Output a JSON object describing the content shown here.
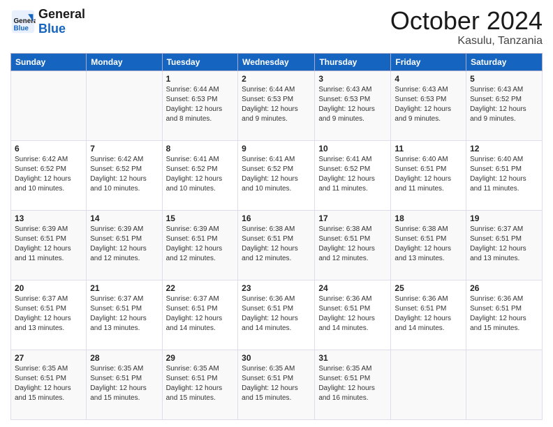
{
  "header": {
    "logo_general": "General",
    "logo_blue": "Blue",
    "month": "October 2024",
    "location": "Kasulu, Tanzania"
  },
  "weekdays": [
    "Sunday",
    "Monday",
    "Tuesday",
    "Wednesday",
    "Thursday",
    "Friday",
    "Saturday"
  ],
  "weeks": [
    [
      null,
      null,
      {
        "day": 1,
        "sunrise": "6:44 AM",
        "sunset": "6:53 PM",
        "daylight": "12 hours and 8 minutes."
      },
      {
        "day": 2,
        "sunrise": "6:44 AM",
        "sunset": "6:53 PM",
        "daylight": "12 hours and 9 minutes."
      },
      {
        "day": 3,
        "sunrise": "6:43 AM",
        "sunset": "6:53 PM",
        "daylight": "12 hours and 9 minutes."
      },
      {
        "day": 4,
        "sunrise": "6:43 AM",
        "sunset": "6:53 PM",
        "daylight": "12 hours and 9 minutes."
      },
      {
        "day": 5,
        "sunrise": "6:43 AM",
        "sunset": "6:52 PM",
        "daylight": "12 hours and 9 minutes."
      }
    ],
    [
      {
        "day": 6,
        "sunrise": "6:42 AM",
        "sunset": "6:52 PM",
        "daylight": "12 hours and 10 minutes."
      },
      {
        "day": 7,
        "sunrise": "6:42 AM",
        "sunset": "6:52 PM",
        "daylight": "12 hours and 10 minutes."
      },
      {
        "day": 8,
        "sunrise": "6:41 AM",
        "sunset": "6:52 PM",
        "daylight": "12 hours and 10 minutes."
      },
      {
        "day": 9,
        "sunrise": "6:41 AM",
        "sunset": "6:52 PM",
        "daylight": "12 hours and 10 minutes."
      },
      {
        "day": 10,
        "sunrise": "6:41 AM",
        "sunset": "6:52 PM",
        "daylight": "12 hours and 11 minutes."
      },
      {
        "day": 11,
        "sunrise": "6:40 AM",
        "sunset": "6:51 PM",
        "daylight": "12 hours and 11 minutes."
      },
      {
        "day": 12,
        "sunrise": "6:40 AM",
        "sunset": "6:51 PM",
        "daylight": "12 hours and 11 minutes."
      }
    ],
    [
      {
        "day": 13,
        "sunrise": "6:39 AM",
        "sunset": "6:51 PM",
        "daylight": "12 hours and 11 minutes."
      },
      {
        "day": 14,
        "sunrise": "6:39 AM",
        "sunset": "6:51 PM",
        "daylight": "12 hours and 12 minutes."
      },
      {
        "day": 15,
        "sunrise": "6:39 AM",
        "sunset": "6:51 PM",
        "daylight": "12 hours and 12 minutes."
      },
      {
        "day": 16,
        "sunrise": "6:38 AM",
        "sunset": "6:51 PM",
        "daylight": "12 hours and 12 minutes."
      },
      {
        "day": 17,
        "sunrise": "6:38 AM",
        "sunset": "6:51 PM",
        "daylight": "12 hours and 12 minutes."
      },
      {
        "day": 18,
        "sunrise": "6:38 AM",
        "sunset": "6:51 PM",
        "daylight": "12 hours and 13 minutes."
      },
      {
        "day": 19,
        "sunrise": "6:37 AM",
        "sunset": "6:51 PM",
        "daylight": "12 hours and 13 minutes."
      }
    ],
    [
      {
        "day": 20,
        "sunrise": "6:37 AM",
        "sunset": "6:51 PM",
        "daylight": "12 hours and 13 minutes."
      },
      {
        "day": 21,
        "sunrise": "6:37 AM",
        "sunset": "6:51 PM",
        "daylight": "12 hours and 13 minutes."
      },
      {
        "day": 22,
        "sunrise": "6:37 AM",
        "sunset": "6:51 PM",
        "daylight": "12 hours and 14 minutes."
      },
      {
        "day": 23,
        "sunrise": "6:36 AM",
        "sunset": "6:51 PM",
        "daylight": "12 hours and 14 minutes."
      },
      {
        "day": 24,
        "sunrise": "6:36 AM",
        "sunset": "6:51 PM",
        "daylight": "12 hours and 14 minutes."
      },
      {
        "day": 25,
        "sunrise": "6:36 AM",
        "sunset": "6:51 PM",
        "daylight": "12 hours and 14 minutes."
      },
      {
        "day": 26,
        "sunrise": "6:36 AM",
        "sunset": "6:51 PM",
        "daylight": "12 hours and 15 minutes."
      }
    ],
    [
      {
        "day": 27,
        "sunrise": "6:35 AM",
        "sunset": "6:51 PM",
        "daylight": "12 hours and 15 minutes."
      },
      {
        "day": 28,
        "sunrise": "6:35 AM",
        "sunset": "6:51 PM",
        "daylight": "12 hours and 15 minutes."
      },
      {
        "day": 29,
        "sunrise": "6:35 AM",
        "sunset": "6:51 PM",
        "daylight": "12 hours and 15 minutes."
      },
      {
        "day": 30,
        "sunrise": "6:35 AM",
        "sunset": "6:51 PM",
        "daylight": "12 hours and 15 minutes."
      },
      {
        "day": 31,
        "sunrise": "6:35 AM",
        "sunset": "6:51 PM",
        "daylight": "12 hours and 16 minutes."
      },
      null,
      null
    ]
  ]
}
